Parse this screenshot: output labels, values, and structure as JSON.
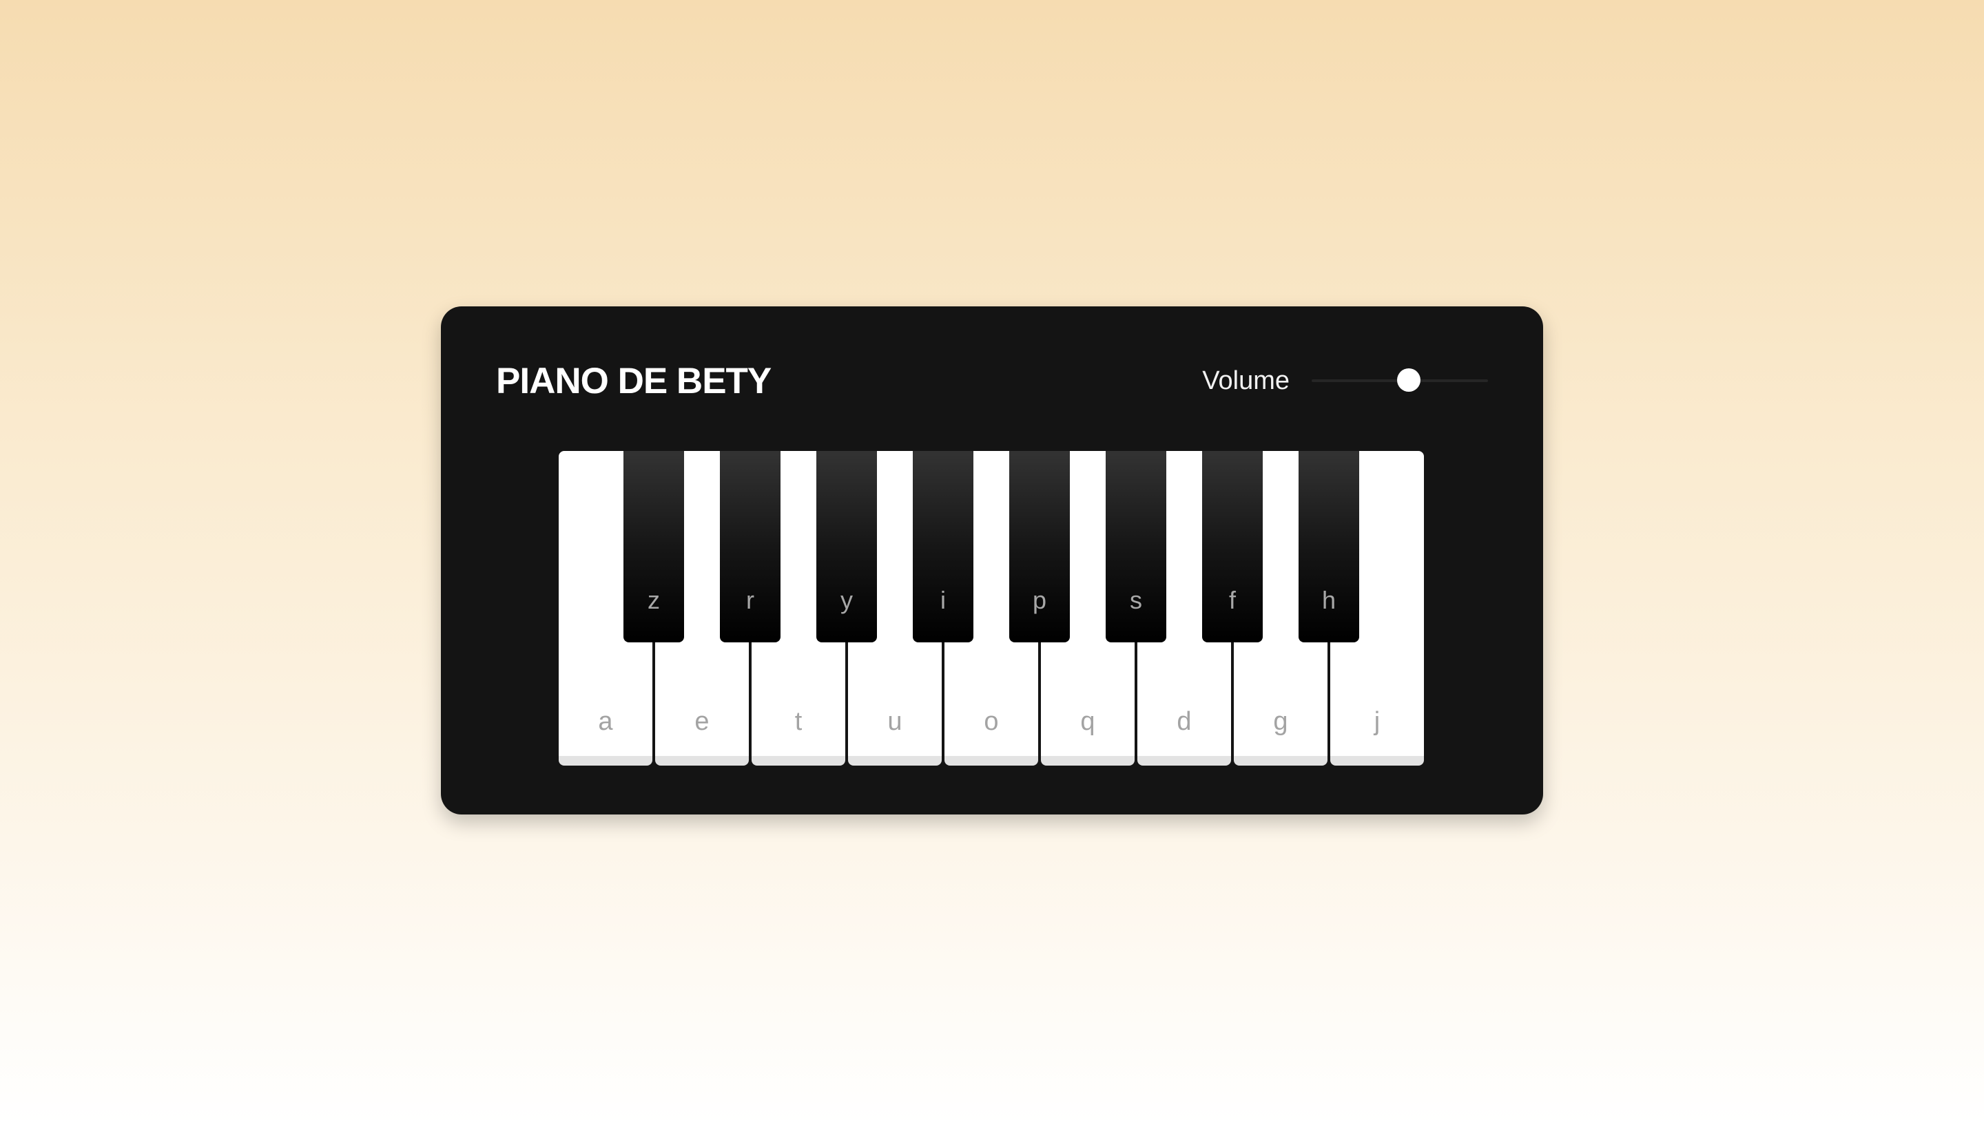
{
  "app": {
    "title": "PIANO DE BETY"
  },
  "volume": {
    "label": "Volume",
    "value": 0.55
  },
  "white_keys": [
    {
      "label": "a"
    },
    {
      "label": "e"
    },
    {
      "label": "t"
    },
    {
      "label": "u"
    },
    {
      "label": "o"
    },
    {
      "label": "q"
    },
    {
      "label": "d"
    },
    {
      "label": "g"
    },
    {
      "label": "j"
    }
  ],
  "black_keys": [
    {
      "label": "z"
    },
    {
      "label": "r"
    },
    {
      "label": "y"
    },
    {
      "label": "i"
    },
    {
      "label": "p"
    },
    {
      "label": "s"
    },
    {
      "label": "f"
    },
    {
      "label": "h"
    }
  ],
  "colors": {
    "panel": "#141414",
    "white_key": "#ffffff",
    "black_key": "#000000",
    "accent_background": "#f6dcb1"
  }
}
